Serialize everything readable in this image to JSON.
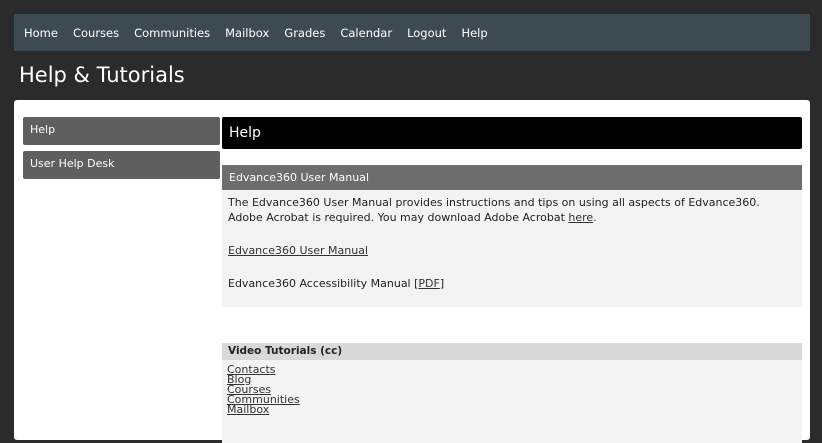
{
  "topnav": {
    "items": [
      "Home",
      "Courses",
      "Communities",
      "Mailbox",
      "Grades",
      "Calendar",
      "Logout",
      "Help"
    ]
  },
  "page": {
    "title": "Help & Tutorials"
  },
  "sidebar": {
    "items": [
      {
        "label": "Help"
      },
      {
        "label": "User Help Desk"
      }
    ]
  },
  "main": {
    "title": "Help",
    "manual_section": {
      "header": "Edvance360 User Manual",
      "description_text": "The Edvance360 User Manual provides instructions and tips on using all aspects of Edvance360. Adobe Acrobat is required. You may download Adobe Acrobat",
      "here_link": "here",
      "period": ".",
      "manual_link": "Edvance360 User Manual",
      "accessibility_text": "Edvance360 Accessibility Manual [",
      "pdf_link": "PDF",
      "accessibility_close": "]"
    },
    "video_section": {
      "header": "Video Tutorials (cc)",
      "links": [
        "Contacts",
        "Blog",
        "Courses",
        "Communities",
        "Mailbox"
      ]
    }
  }
}
